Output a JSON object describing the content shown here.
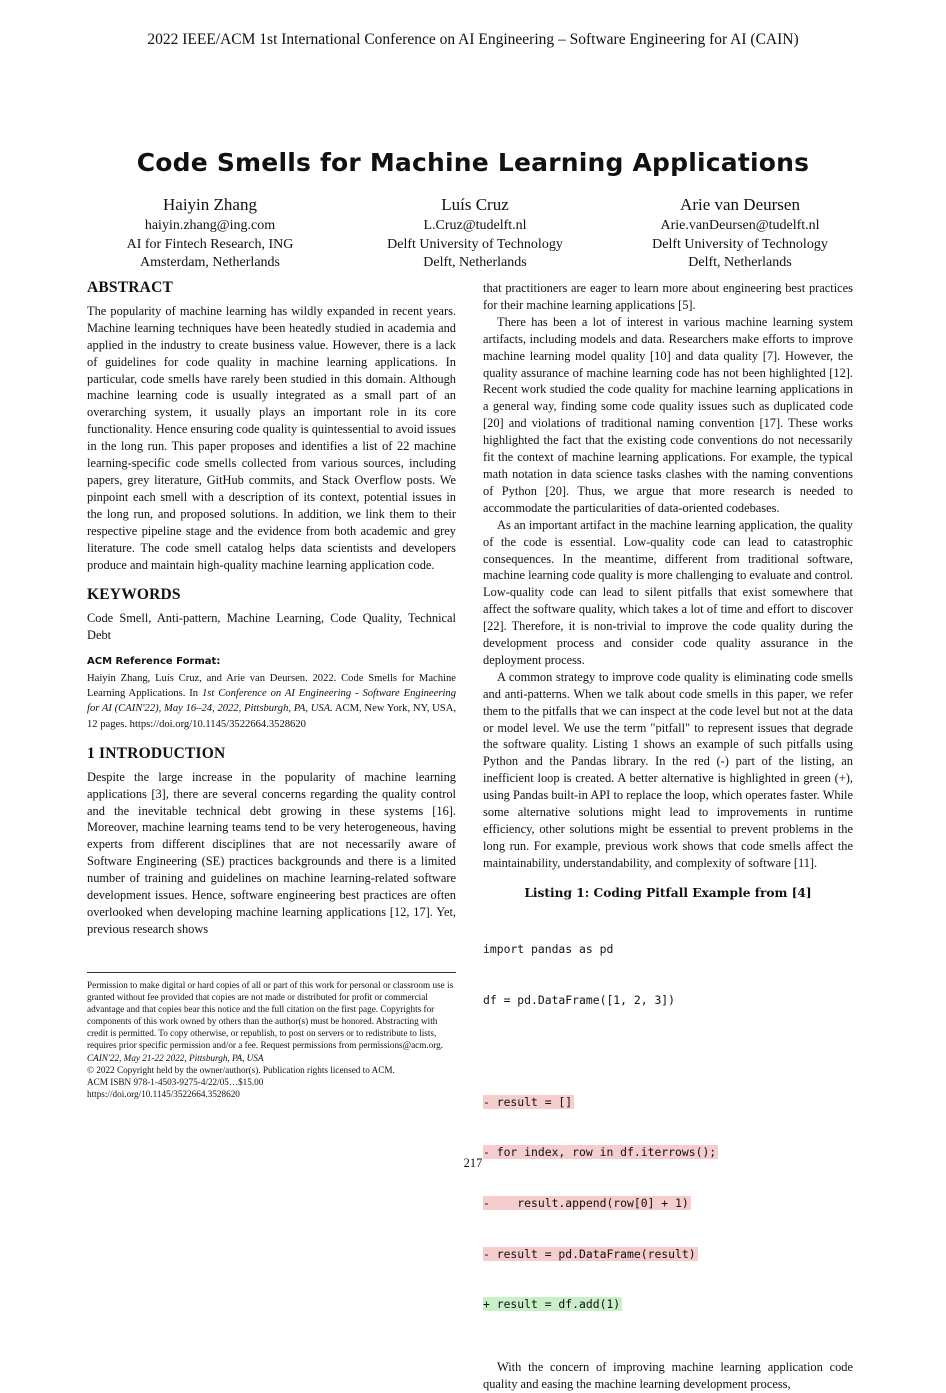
{
  "header": {
    "conference": "2022 IEEE/ACM 1st International Conference on AI Engineering – Software Engineering for AI (CAIN)"
  },
  "title": "Code Smells for Machine Learning Applications",
  "authors": [
    {
      "name": "Haiyin Zhang",
      "email": "haiyin.zhang@ing.com",
      "affiliation": "AI for Fintech Research, ING",
      "location": "Amsterdam, Netherlands"
    },
    {
      "name": "Luís Cruz",
      "email": "L.Cruz@tudelft.nl",
      "affiliation": "Delft University of Technology",
      "location": "Delft, Netherlands"
    },
    {
      "name": "Arie van Deursen",
      "email": "Arie.vanDeursen@tudelft.nl",
      "affiliation": "Delft University of Technology",
      "location": "Delft, Netherlands"
    }
  ],
  "abstract": {
    "heading": "ABSTRACT",
    "text": "The popularity of machine learning has wildly expanded in recent years. Machine learning techniques have been heatedly studied in academia and applied in the industry to create business value. However, there is a lack of guidelines for code quality in machine learning applications. In particular, code smells have rarely been studied in this domain. Although machine learning code is usually integrated as a small part of an overarching system, it usually plays an important role in its core functionality. Hence ensuring code quality is quintessential to avoid issues in the long run. This paper proposes and identifies a list of 22 machine learning-specific code smells collected from various sources, including papers, grey literature, GitHub commits, and Stack Overflow posts. We pinpoint each smell with a description of its context, potential issues in the long run, and proposed solutions. In addition, we link them to their respective pipeline stage and the evidence from both academic and grey literature. The code smell catalog helps data scientists and developers produce and maintain high-quality machine learning application code."
  },
  "keywords": {
    "heading": "KEYWORDS",
    "text": "Code Smell, Anti-pattern, Machine Learning, Code Quality, Technical Debt"
  },
  "acm_reference": {
    "heading": "ACM Reference Format:",
    "part1": "Haiyin Zhang, Luís Cruz, and Arie van Deursen. 2022. Code Smells for Machine Learning Applications. In ",
    "venue": "1st Conference on AI Engineering - Software Engineering for AI (CAIN'22), May 16–24, 2022, Pittsburgh, PA, USA.",
    "part2": " ACM, New York, NY, USA, 12 pages. https://doi.org/10.1145/3522664.3528620"
  },
  "introduction": {
    "heading": "1   INTRODUCTION",
    "paragraphs": [
      "Despite the large increase in the popularity of machine learning applications [3], there are several concerns regarding the quality control and the inevitable technical debt growing in these systems [16]. Moreover, machine learning teams tend to be very heterogeneous, having experts from different disciplines that are not necessarily aware of Software Engineering (SE) practices backgrounds and there is a limited number of training and guidelines on machine learning-related software development issues. Hence, software engineering best practices are often overlooked when developing machine learning applications [12, 17]. Yet, previous research shows"
    ]
  },
  "right_column": {
    "paragraphs": [
      "that practitioners are eager to learn more about engineering best practices for their machine learning applications [5].",
      "There has been a lot of interest in various machine learning system artifacts, including models and data. Researchers make efforts to improve machine learning model quality [10] and data quality [7]. However, the quality assurance of machine learning code has not been highlighted [12]. Recent work studied the code quality for machine learning applications in a general way, finding some code quality issues such as duplicated code [20] and violations of traditional naming convention [17]. These works highlighted the fact that the existing code conventions do not necessarily fit the context of machine learning applications. For example, the typical math notation in data science tasks clashes with the naming conventions of Python [20]. Thus, we argue that more research is needed to accommodate the particularities of data-oriented codebases.",
      "As an important artifact in the machine learning application, the quality of the code is essential. Low-quality code can lead to catastrophic consequences. In the meantime, different from traditional software, machine learning code quality is more challenging to evaluate and control. Low-quality code can lead to silent pitfalls that exist somewhere that affect the software quality, which takes a lot of time and effort to discover [22]. Therefore, it is non-trivial to improve the code quality during the development process and consider code quality assurance in the deployment process.",
      "A common strategy to improve code quality is eliminating code smells and anti-patterns. When we talk about code smells in this paper, we refer them to the pitfalls that we can inspect at the code level but not at the data or model level. We use the term \"pitfall\" to represent issues that degrade the software quality. Listing 1 shows an example of such pitfalls using Python and the Pandas library. In the red (-) part of the listing, an inefficient loop is created. A better alternative is highlighted in green (+), using Pandas built-in API to replace the loop, which operates faster. While some alternative solutions might lead to improvements in runtime efficiency, other solutions might be essential to prevent problems in the long run. For example, previous work shows that code smells affect the maintainability, understandability, and complexity of software [11]."
    ],
    "final_paragraph": "With the concern of improving machine learning application code quality and easing the machine learning development process,"
  },
  "listing": {
    "caption": "Listing 1: Coding Pitfall Example from [4]",
    "lines": [
      {
        "kind": "plain",
        "text": "import pandas as pd"
      },
      {
        "kind": "plain",
        "text": "df = pd.DataFrame([1, 2, 3])"
      },
      {
        "kind": "blank",
        "text": ""
      },
      {
        "kind": "del",
        "text": "- result = []"
      },
      {
        "kind": "del",
        "text": "- for index, row in df.iterrows();"
      },
      {
        "kind": "del",
        "text": "-    result.append(row[0] + 1)"
      },
      {
        "kind": "del",
        "text": "- result = pd.DataFrame(result)"
      },
      {
        "kind": "add",
        "text": "+ result = df.add(1)"
      }
    ]
  },
  "footnote": {
    "permission": "Permission to make digital or hard copies of all or part of this work for personal or classroom use is granted without fee provided that copies are not made or distributed for profit or commercial advantage and that copies bear this notice and the full citation on the first page. Copyrights for components of this work owned by others than the author(s) must be honored. Abstracting with credit is permitted. To copy otherwise, or republish, to post on servers or to redistribute to lists, requires prior specific permission and/or a fee. Request permissions from permissions@acm.org.",
    "venue": "CAIN'22, May 21-22 2022, Pittsburgh, PA, USA",
    "copyright": "© 2022 Copyright held by the owner/author(s). Publication rights licensed to ACM.",
    "isbn": "ACM ISBN 978-1-4503-9275-4/22/05…$15.00",
    "doi": "https://doi.org/10.1145/3522664.3528620"
  },
  "page_number": "217"
}
